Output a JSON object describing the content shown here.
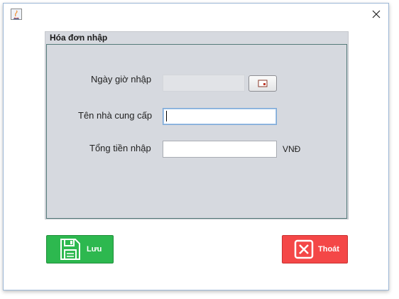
{
  "window": {
    "title": ""
  },
  "panel": {
    "title": "Hóa đơn nhập"
  },
  "form": {
    "date_label": "Ngày giờ nhập",
    "date_value": "",
    "supplier_label": "Tên nhà cung cấp",
    "supplier_value": "",
    "total_label": "Tổng tiền nhập",
    "total_value": "",
    "currency": "VNĐ"
  },
  "buttons": {
    "save_label": "Lưu",
    "exit_label": "Thoát"
  },
  "icons": {
    "app": "java-app-icon",
    "close": "close-icon",
    "calendar": "calendar-icon",
    "save": "floppy-disk-icon",
    "exit": "x-box-icon"
  },
  "colors": {
    "save": "#2db84f",
    "exit": "#f44747",
    "panel": "#d6d9df"
  }
}
